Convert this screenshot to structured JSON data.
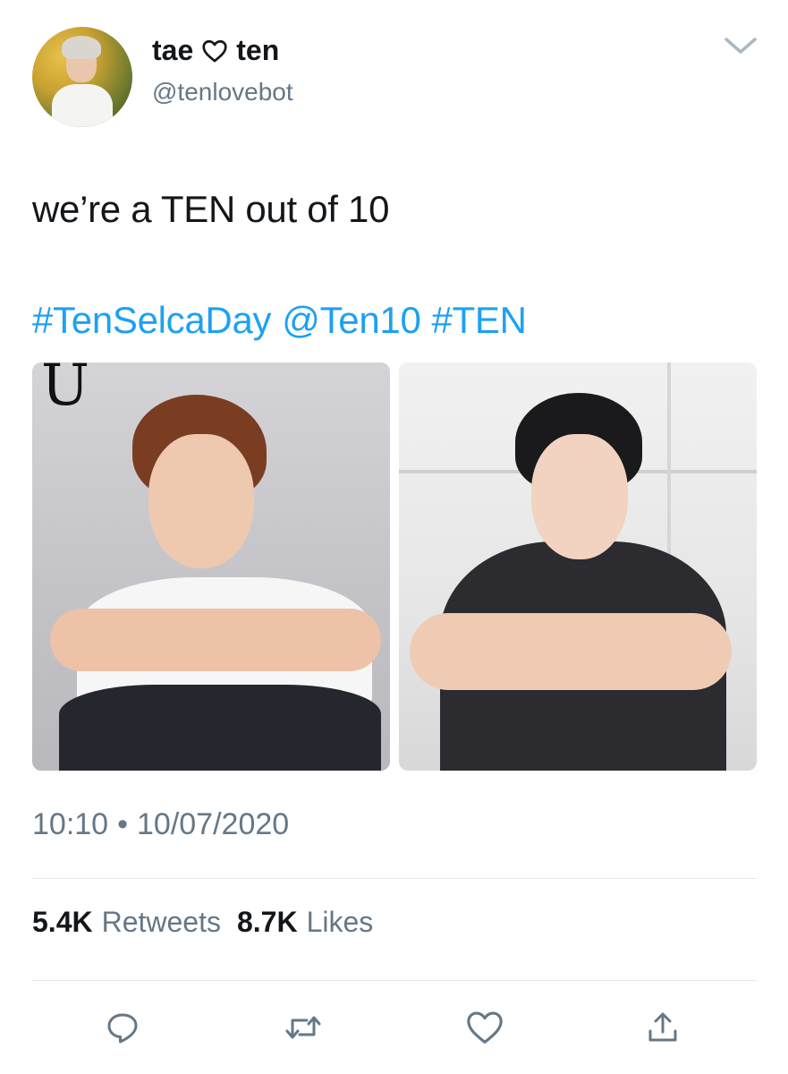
{
  "user": {
    "display_name_left": "tae",
    "display_name_right": "ten",
    "handle": "@tenlovebot"
  },
  "tweet": {
    "text": "we’re a TEN out of 10",
    "tags": [
      "#TenSelcaDay",
      "@Ten10",
      "#TEN"
    ]
  },
  "photos": {
    "first_logo_text": "U"
  },
  "meta": {
    "time": "10:10",
    "separator": "•",
    "date": "10/07/2020"
  },
  "stats": {
    "retweets_count": "5.4K",
    "retweets_label": "Retweets",
    "likes_count": "8.7K",
    "likes_label": "Likes"
  },
  "colors": {
    "link": "#1da1f2",
    "secondary_text": "#657786",
    "primary_text": "#14171a"
  },
  "icons": {
    "name_heart": "heart-outline-icon",
    "caret": "chevron-down-icon",
    "actions": [
      "reply-icon",
      "retweet-icon",
      "like-icon",
      "share-icon"
    ]
  }
}
